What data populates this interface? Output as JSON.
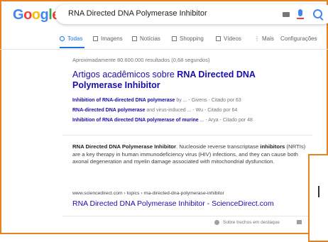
{
  "logo": {
    "letters": [
      "G",
      "o",
      "o",
      "g",
      "l",
      "e"
    ],
    "colors": [
      "#4285f4",
      "#ea4335",
      "#fbbc05",
      "#4285f4",
      "#34a853",
      "#ea4335"
    ]
  },
  "search": {
    "query": "RNA Directed DNA Polymerase Inhibitor"
  },
  "tabs": [
    {
      "label": "Todas",
      "icon": "search-icon"
    },
    {
      "label": "Imagens",
      "icon": "image-icon"
    },
    {
      "label": "Notícias",
      "icon": "news-icon"
    },
    {
      "label": "Shopping",
      "icon": "tag-icon"
    },
    {
      "label": "Vídeos",
      "icon": "play-icon"
    },
    {
      "label": "Mais",
      "icon": "dots-icon"
    },
    {
      "label": "Configurações",
      "icon": ""
    }
  ],
  "stats": "Aproximadamente 80.600.000 resultados (0,68 segundos)",
  "scholar": {
    "title_prefix": "Artigos acadêmicos sobre ",
    "title_query": "RNA Directed DNA Polymerase Inhibitor",
    "items": [
      {
        "link": "Inhibition of RNA-directed DNA polymerase",
        "meta": " by ... - Givens - Citado por 63"
      },
      {
        "link": "RNA-directed DNA polymerase",
        "meta": " and virus-induced ... - Wu - Citado por 64"
      },
      {
        "link": "Inhibition of RNA directed DNA polymerase of murine",
        "meta": " ... - Arya - Citado por 48"
      }
    ]
  },
  "featured": {
    "snippet_bold1": "RNA Directed DNA Polymerase Inhibitor",
    "snippet_text1": ". Nucleoside reverse transcriptase ",
    "snippet_bold2": "inhibitors",
    "snippet_text2": " (NRTIs) are a key therapy in human immunodeficiency virus (HIV) infections, and they can cause both axonal degeneration and myelin damage associated with mitochondrial dysfunction.",
    "cite": "www.sciencedirect.com › topics › rna-directed-dna-polymerase-inhibitor",
    "title": "RNA Directed DNA Polymerase Inhibitor - ScienceDirect.com",
    "footnote": "Sobre trechos em destaque"
  },
  "accent_color": "#e8821e"
}
